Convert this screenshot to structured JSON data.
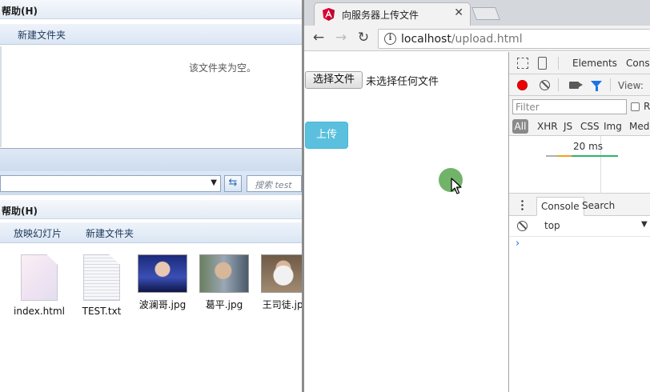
{
  "explorer_top": {
    "menu_label": "帮助(H)",
    "commands": [
      "新建文件夹"
    ],
    "empty_message": "该文件夹为空。"
  },
  "explorer_bottom": {
    "search_placeholder": "搜索 test",
    "menu_label": "帮助(H)",
    "commands": [
      "放映幻灯片",
      "新建文件夹"
    ],
    "files": [
      {
        "name": "index.html",
        "icon": "html-file-icon"
      },
      {
        "name": "TEST.txt",
        "icon": "text-file-icon"
      },
      {
        "name": "波澜哥.jpg",
        "icon": "photo-thumbnail"
      },
      {
        "name": "葛平.jpg",
        "icon": "photo-thumbnail"
      },
      {
        "name": "王司徒.jpg",
        "icon": "photo-thumbnail"
      }
    ]
  },
  "browser": {
    "tab_title": "向服务器上传文件",
    "url_host": "localhost",
    "url_path": "/upload.html",
    "page": {
      "choose_file_label": "选择文件",
      "no_file_text": "未选择任何文件",
      "upload_label": "上传"
    }
  },
  "devtools": {
    "tabs": [
      "Elements",
      "Conso"
    ],
    "view_label": "View:",
    "filter_placeholder": "Filter",
    "regex_label": "R",
    "type_filters": [
      "All",
      "XHR",
      "JS",
      "CSS",
      "Img",
      "Medi"
    ],
    "timeline_label": "20 ms",
    "drawer_tabs": [
      "Console",
      "Search"
    ],
    "context": "top",
    "prompt": "›"
  },
  "colors": {
    "upload_button": "#5bc0de",
    "record": "#ee0000",
    "accent_blue": "#1a73e8",
    "click_indicator": "#72b36a"
  }
}
